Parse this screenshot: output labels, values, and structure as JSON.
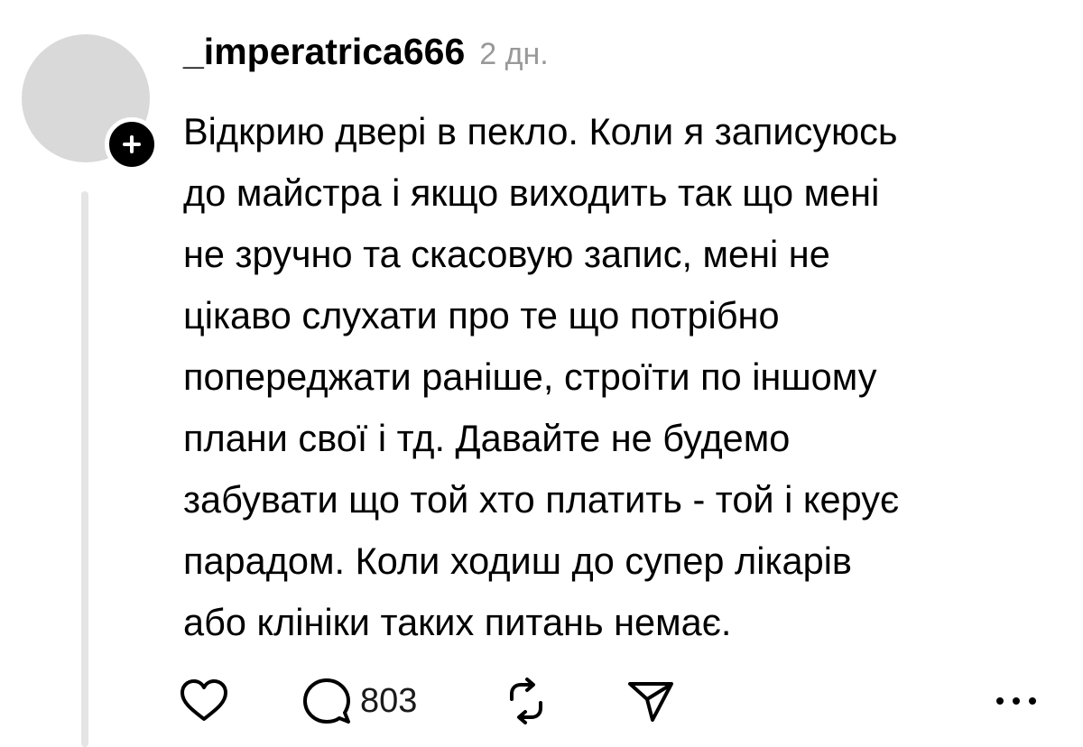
{
  "post": {
    "author": {
      "username": "_imperatrica666",
      "avatar_color": "#d9d9d9",
      "follow_icon": "plus-icon"
    },
    "timestamp": "2 дн.",
    "text_lines": [
      "Відкрию двері в пекло. Коли я записуюсь",
      "до майстра і якщо виходить так що мені",
      "не зручно та скасовую запис, мені не",
      "цікаво слухати про те що потрібно",
      "попереджати раніше, строїти по іншому",
      "плани свої і тд. Давайте не будемо",
      "забувати що той хто платить - той і керує",
      "парадом. Коли ходиш до супер лікарів",
      "або клініки таких питань немає."
    ]
  },
  "actions": {
    "like_icon": "heart-icon",
    "reply_icon": "speech-bubble-icon",
    "reply_count": "803",
    "repost_icon": "repost-icon",
    "share_icon": "paper-plane-icon",
    "more_icon": "ellipsis-icon"
  },
  "colors": {
    "text": "#000000",
    "timestamp": "#999999",
    "thread_line": "#e5e5e5"
  }
}
